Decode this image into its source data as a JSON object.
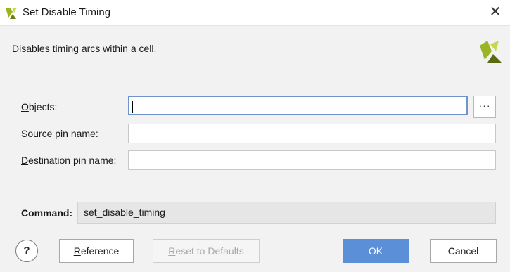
{
  "window": {
    "title": "Set Disable Timing",
    "icon": "vivado-logo-icon",
    "close_icon": "close-icon",
    "close_glyph": "✕"
  },
  "description": "Disables timing arcs within a cell.",
  "form": {
    "objects": {
      "label_mnemonic": "O",
      "label_rest": "bjects:",
      "value": "",
      "placeholder": ""
    },
    "source_pin": {
      "label_mnemonic": "S",
      "label_rest": "ource pin name:",
      "value": "",
      "placeholder": ""
    },
    "destination_pin": {
      "label_mnemonic": "D",
      "label_rest": "estination pin name:",
      "value": "",
      "placeholder": ""
    },
    "browse_label": "···"
  },
  "command": {
    "label": "Command:",
    "value": "set_disable_timing"
  },
  "buttons": {
    "help": "?",
    "reference_mnemonic": "R",
    "reference_rest": "eference",
    "reset_mnemonic": "R",
    "reset_rest": "eset to Defaults",
    "ok": "OK",
    "cancel": "Cancel"
  },
  "colors": {
    "accent": "#5b8fd8",
    "logo_green": "#9ab423",
    "logo_dark": "#5a6a12",
    "focus_border": "#6f95c8"
  }
}
